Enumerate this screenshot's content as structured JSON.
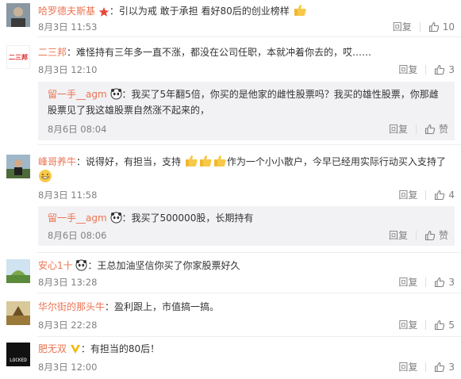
{
  "actions": {
    "reply_label": "回复",
    "like_label": "赞"
  },
  "comments": [
    {
      "user": "哈罗德夫斯基",
      "separator": "：",
      "text": "引以为戒 敢于承担 看好80后的创业榜样",
      "date": "8月3日 11:53",
      "likes": "10"
    },
    {
      "user": "二三邦",
      "separator": "：",
      "text": "难怪持有三年多一直不涨，都没在公司任职，本就冲着你去的，哎……",
      "date": "8月3日 12:10",
      "likes": "3",
      "avatar_text": "二三邦",
      "reply": {
        "user": "留一手__agm",
        "separator": "：",
        "text_line1": "我买了5年翻5倍，你买的是他家的雌性股票吗？我买的雄性股票，你那雌",
        "text_line2": "股票见了我这雄股票自然涨不起来的，",
        "date": "8月6日 08:04"
      }
    },
    {
      "user": "峰哥养牛",
      "separator": "：",
      "text_a": "说得好，有担当，支持",
      "text_b": "作为一个小小散户，今早已经用实际行动买入支持了",
      "date": "8月3日 11:58",
      "likes": "4",
      "reply": {
        "user": "留一手__agm",
        "separator": "：",
        "text_line1": "我买了500000股，长期持有",
        "date": "8月6日 08:06"
      }
    },
    {
      "user": "安心1十",
      "separator": "：",
      "text": "王总加油坚信你买了你家股票好久",
      "date": "8月3日 13:28",
      "likes": "3"
    },
    {
      "user": "华尔街的那头牛",
      "separator": "：",
      "text": "盈利跟上，市值搞一搞。",
      "date": "8月3日 22:28",
      "likes": "5"
    },
    {
      "user": "肥无双",
      "separator": "：",
      "text": "有担当的80后！",
      "date": "8月3日 12:00",
      "likes": "3",
      "avatar_text": "LOCKED"
    }
  ]
}
